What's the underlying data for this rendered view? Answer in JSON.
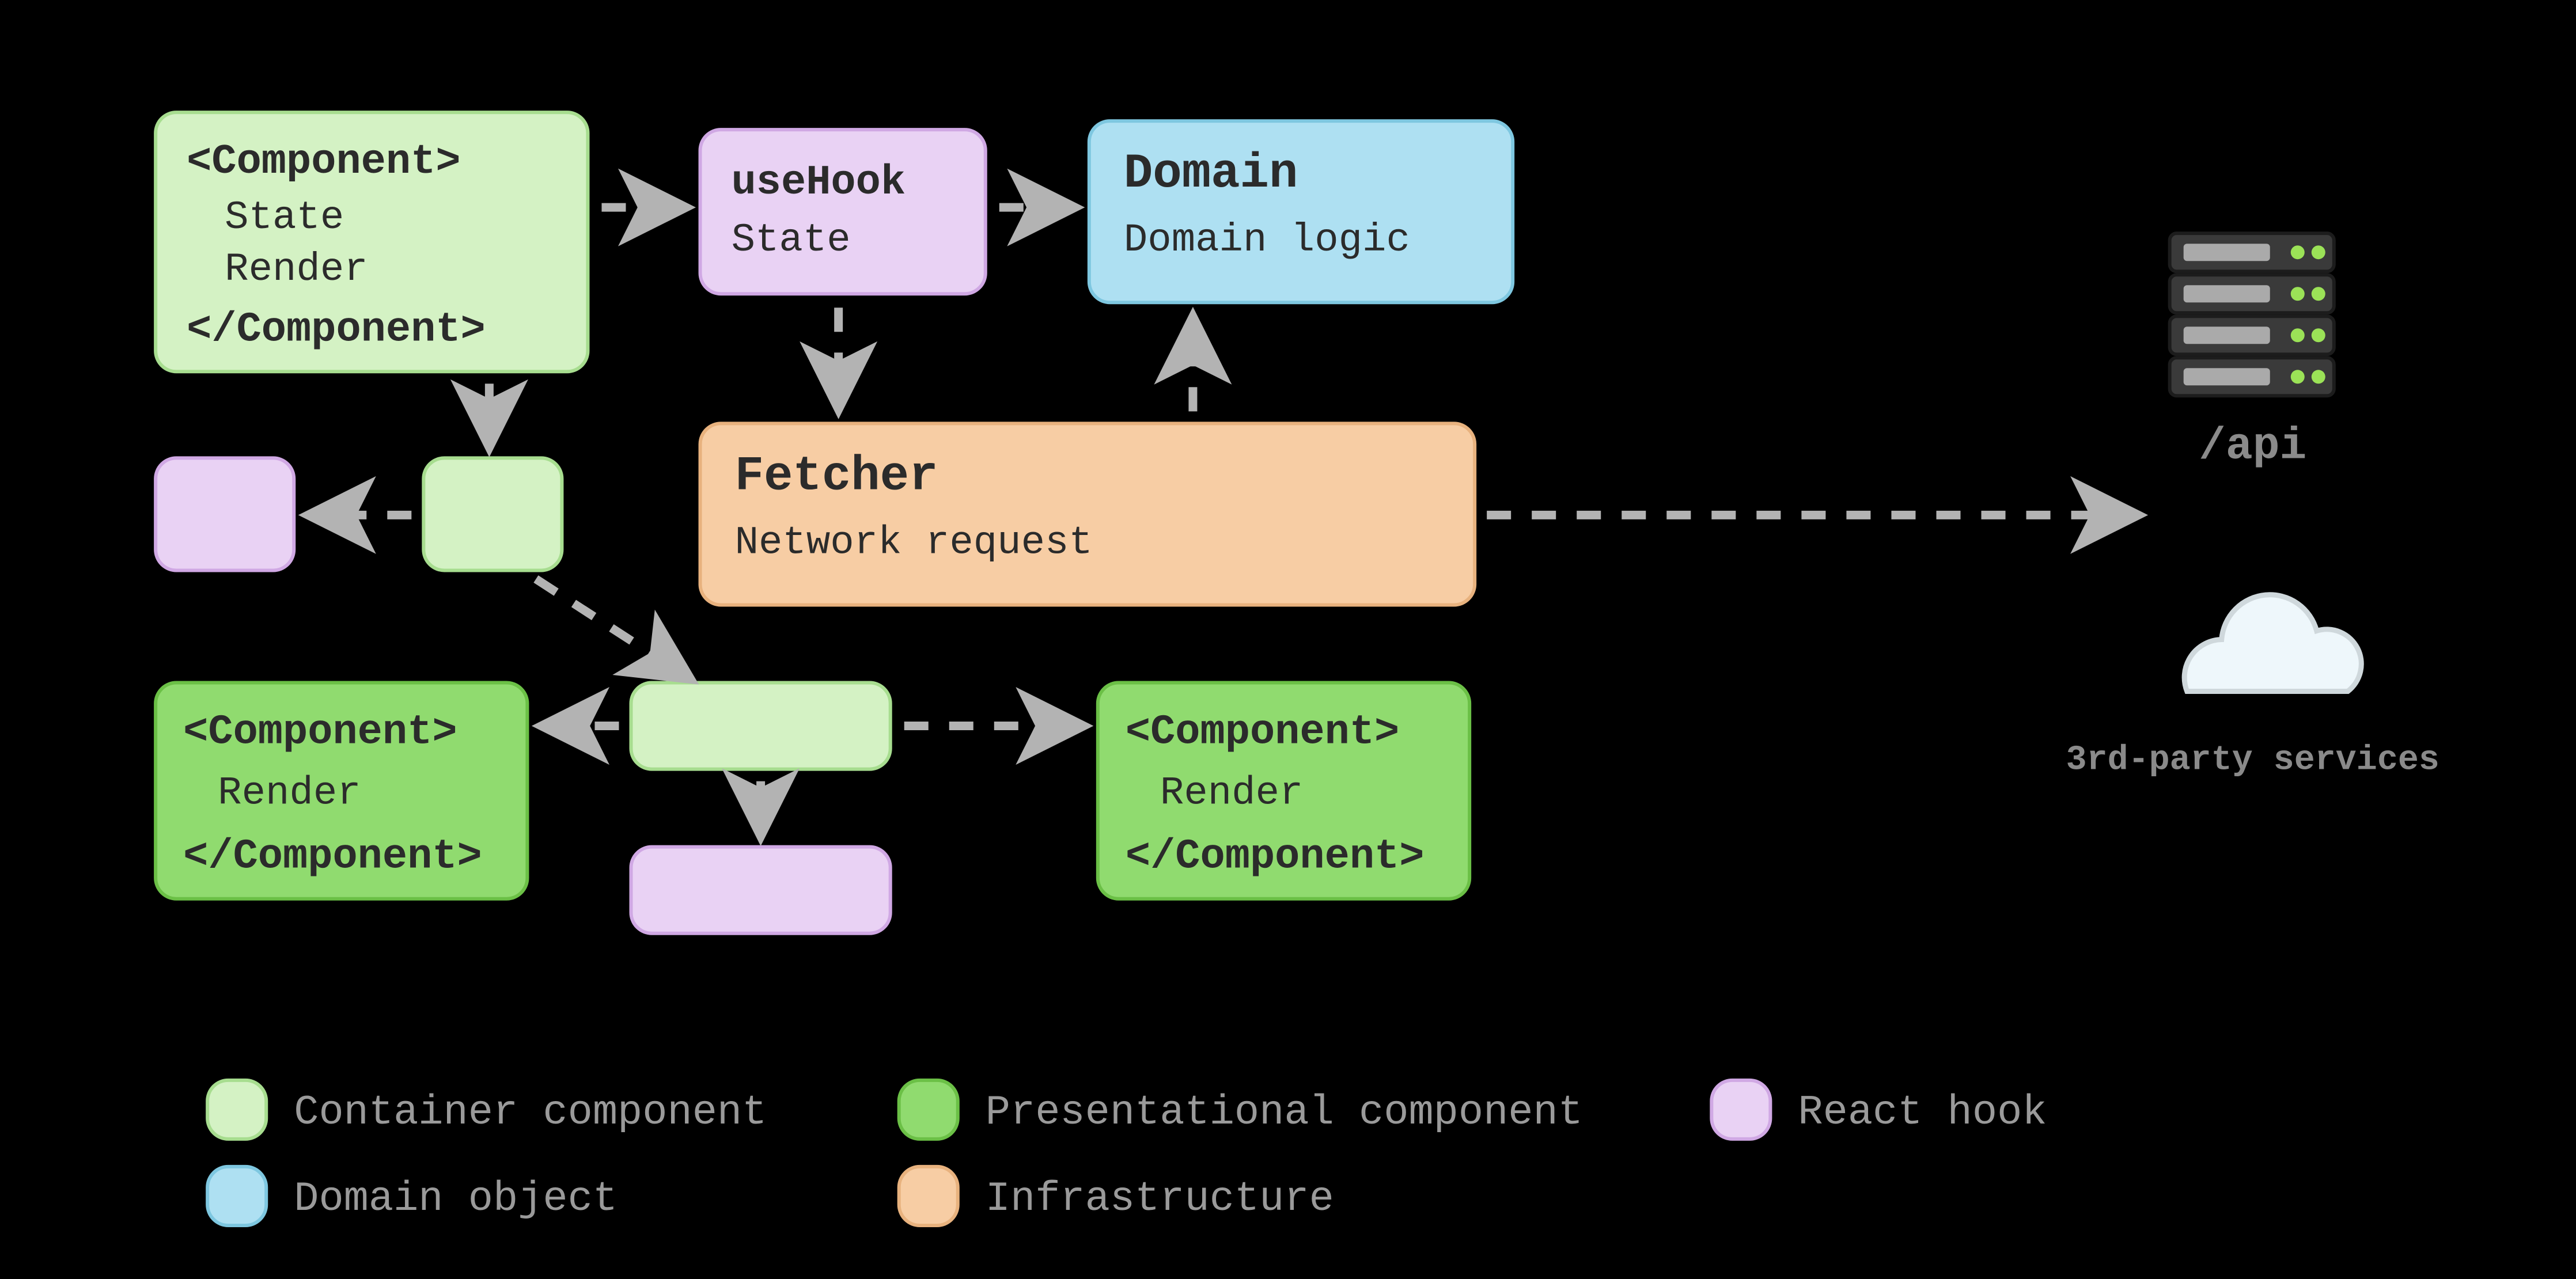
{
  "nodes": {
    "container_main": {
      "open": "<Component>",
      "l1": "State",
      "l2": "Render",
      "close": "</Component>"
    },
    "hook_main": {
      "title": "useHook",
      "l1": "State"
    },
    "domain": {
      "title": "Domain",
      "l1": "Domain logic"
    },
    "fetcher": {
      "title": "Fetcher",
      "l1": "Network request"
    },
    "pres_left": {
      "open": "<Component>",
      "l1": "Render",
      "close": "</Component>"
    },
    "pres_right": {
      "open": "<Component>",
      "l1": "Render",
      "close": "</Component>"
    }
  },
  "api_label": "/api",
  "third_party_label": "3rd-party services",
  "legend": {
    "container": "Container component",
    "presentational": "Presentational component",
    "hook": "React hook",
    "domain": "Domain object",
    "infra": "Infrastructure"
  },
  "colors": {
    "container_fill": "#d4f2c4",
    "container_stroke": "#a7dd8f",
    "pres_fill": "#90db6f",
    "pres_stroke": "#6bc046",
    "hook_fill": "#e9d2f4",
    "hook_stroke": "#d0a8e4",
    "domain_fill": "#aee0f2",
    "domain_stroke": "#7ec7e0",
    "infra_fill": "#f7cda4",
    "infra_stroke": "#e8b27e"
  }
}
